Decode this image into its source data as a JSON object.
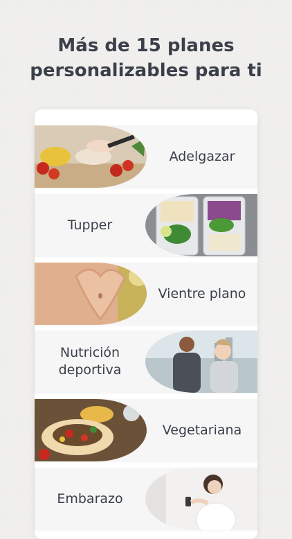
{
  "headline": {
    "line1": "Más de 15 planes",
    "line2": "personalizables para ti"
  },
  "plans": [
    {
      "label": "Adelgazar"
    },
    {
      "label": "Tupper"
    },
    {
      "label": "Vientre plano"
    },
    {
      "label_line1": "Nutrición",
      "label_line2": "deportiva"
    },
    {
      "label": "Vegetariana"
    },
    {
      "label": "Embarazo"
    }
  ]
}
